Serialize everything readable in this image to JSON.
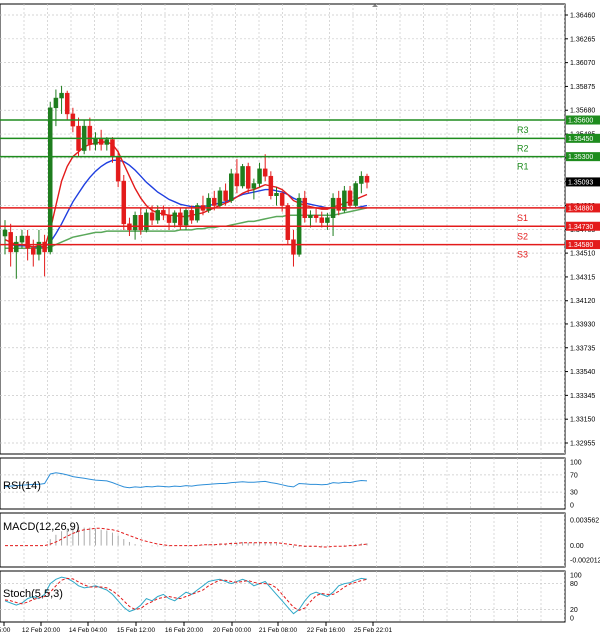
{
  "chart_data": {
    "type": "candlestick",
    "symbol_price_scale": {
      "ticks": [
        "1.36460",
        "1.36265",
        "1.36070",
        "1.35875",
        "1.35680",
        "1.35485",
        "1.35290",
        "1.35095",
        "1.34900",
        "1.34705",
        "1.34510",
        "1.34315",
        "1.34120",
        "1.33930",
        "1.33735",
        "1.33540",
        "1.33345",
        "1.33150",
        "1.32955"
      ],
      "current_price": "1.35093",
      "ylim": [
        1.32955,
        1.3646
      ]
    },
    "x_labels": [
      "5:00",
      "12 Feb 20:00",
      "14 Feb 04:00",
      "15 Feb 12:00",
      "16 Feb 20:00",
      "20 Feb 00:00",
      "21 Feb 08:00",
      "22 Feb 16:00",
      "25 Feb 22:01"
    ],
    "levels": [
      {
        "name": "R3",
        "price": 1.356,
        "label": "1.35600",
        "color": "#1e8c1e"
      },
      {
        "name": "R2",
        "price": 1.3545,
        "label": "1.35450",
        "color": "#1e8c1e"
      },
      {
        "name": "R1",
        "price": 1.353,
        "label": "1.35300",
        "color": "#1e8c1e"
      },
      {
        "name": "S1",
        "price": 1.3488,
        "label": "1.34880",
        "color": "#e31b1b"
      },
      {
        "name": "S2",
        "price": 1.3473,
        "label": "1.34730",
        "color": "#e31b1b"
      },
      {
        "name": "S3",
        "price": 1.3458,
        "label": "1.34580",
        "color": "#e31b1b"
      }
    ],
    "candles": [
      {
        "o": 1.3465,
        "h": 1.3478,
        "l": 1.345,
        "c": 1.347
      },
      {
        "o": 1.3468,
        "h": 1.3475,
        "l": 1.344,
        "c": 1.3452
      },
      {
        "o": 1.3452,
        "h": 1.3465,
        "l": 1.343,
        "c": 1.346
      },
      {
        "o": 1.346,
        "h": 1.347,
        "l": 1.3455,
        "c": 1.3465
      },
      {
        "o": 1.3465,
        "h": 1.347,
        "l": 1.3445,
        "c": 1.3455
      },
      {
        "o": 1.3455,
        "h": 1.3462,
        "l": 1.344,
        "c": 1.345
      },
      {
        "o": 1.345,
        "h": 1.347,
        "l": 1.3445,
        "c": 1.346
      },
      {
        "o": 1.346,
        "h": 1.3466,
        "l": 1.3432,
        "c": 1.3452
      },
      {
        "o": 1.3452,
        "h": 1.3575,
        "l": 1.345,
        "c": 1.357
      },
      {
        "o": 1.357,
        "h": 1.3585,
        "l": 1.3555,
        "c": 1.3578
      },
      {
        "o": 1.3578,
        "h": 1.3588,
        "l": 1.3565,
        "c": 1.3582
      },
      {
        "o": 1.3582,
        "h": 1.3584,
        "l": 1.356,
        "c": 1.3565
      },
      {
        "o": 1.3565,
        "h": 1.357,
        "l": 1.355,
        "c": 1.3555
      },
      {
        "o": 1.3555,
        "h": 1.3562,
        "l": 1.353,
        "c": 1.3535
      },
      {
        "o": 1.3535,
        "h": 1.356,
        "l": 1.3532,
        "c": 1.3555
      },
      {
        "o": 1.3555,
        "h": 1.3562,
        "l": 1.3535,
        "c": 1.354
      },
      {
        "o": 1.354,
        "h": 1.355,
        "l": 1.3535,
        "c": 1.3545
      },
      {
        "o": 1.3545,
        "h": 1.3552,
        "l": 1.3535,
        "c": 1.354
      },
      {
        "o": 1.354,
        "h": 1.3546,
        "l": 1.3535,
        "c": 1.3544
      },
      {
        "o": 1.3544,
        "h": 1.3546,
        "l": 1.3525,
        "c": 1.353
      },
      {
        "o": 1.353,
        "h": 1.3535,
        "l": 1.3505,
        "c": 1.351
      },
      {
        "o": 1.351,
        "h": 1.3515,
        "l": 1.347,
        "c": 1.3475
      },
      {
        "o": 1.3475,
        "h": 1.348,
        "l": 1.3465,
        "c": 1.347
      },
      {
        "o": 1.347,
        "h": 1.3485,
        "l": 1.3462,
        "c": 1.3482
      },
      {
        "o": 1.3482,
        "h": 1.3488,
        "l": 1.3466,
        "c": 1.347
      },
      {
        "o": 1.347,
        "h": 1.3487,
        "l": 1.3468,
        "c": 1.3484
      },
      {
        "o": 1.3484,
        "h": 1.349,
        "l": 1.3474,
        "c": 1.3478
      },
      {
        "o": 1.3478,
        "h": 1.349,
        "l": 1.3475,
        "c": 1.3486
      },
      {
        "o": 1.3486,
        "h": 1.349,
        "l": 1.3478,
        "c": 1.3482
      },
      {
        "o": 1.3482,
        "h": 1.3488,
        "l": 1.347,
        "c": 1.3476
      },
      {
        "o": 1.3476,
        "h": 1.3486,
        "l": 1.3472,
        "c": 1.3484
      },
      {
        "o": 1.3484,
        "h": 1.3488,
        "l": 1.347,
        "c": 1.3474
      },
      {
        "o": 1.3474,
        "h": 1.3488,
        "l": 1.347,
        "c": 1.3486
      },
      {
        "o": 1.3486,
        "h": 1.349,
        "l": 1.3475,
        "c": 1.3478
      },
      {
        "o": 1.3478,
        "h": 1.3492,
        "l": 1.3476,
        "c": 1.349
      },
      {
        "o": 1.349,
        "h": 1.3498,
        "l": 1.3482,
        "c": 1.3486
      },
      {
        "o": 1.3486,
        "h": 1.35,
        "l": 1.3484,
        "c": 1.3496
      },
      {
        "o": 1.3496,
        "h": 1.3502,
        "l": 1.3486,
        "c": 1.349
      },
      {
        "o": 1.349,
        "h": 1.3505,
        "l": 1.3488,
        "c": 1.3502
      },
      {
        "o": 1.3502,
        "h": 1.3508,
        "l": 1.349,
        "c": 1.3494
      },
      {
        "o": 1.3494,
        "h": 1.352,
        "l": 1.3492,
        "c": 1.3516
      },
      {
        "o": 1.3516,
        "h": 1.3528,
        "l": 1.35,
        "c": 1.3506
      },
      {
        "o": 1.3506,
        "h": 1.3524,
        "l": 1.3504,
        "c": 1.3522
      },
      {
        "o": 1.3522,
        "h": 1.3525,
        "l": 1.35,
        "c": 1.3504
      },
      {
        "o": 1.3504,
        "h": 1.3512,
        "l": 1.3495,
        "c": 1.3508
      },
      {
        "o": 1.3508,
        "h": 1.3525,
        "l": 1.3505,
        "c": 1.352
      },
      {
        "o": 1.352,
        "h": 1.3532,
        "l": 1.351,
        "c": 1.3514
      },
      {
        "o": 1.3514,
        "h": 1.3518,
        "l": 1.3495,
        "c": 1.3498
      },
      {
        "o": 1.3498,
        "h": 1.3505,
        "l": 1.349,
        "c": 1.35
      },
      {
        "o": 1.35,
        "h": 1.3502,
        "l": 1.3485,
        "c": 1.349
      },
      {
        "o": 1.349,
        "h": 1.3492,
        "l": 1.3458,
        "c": 1.3462
      },
      {
        "o": 1.3462,
        "h": 1.347,
        "l": 1.344,
        "c": 1.345
      },
      {
        "o": 1.345,
        "h": 1.35,
        "l": 1.3448,
        "c": 1.3496
      },
      {
        "o": 1.3496,
        "h": 1.3502,
        "l": 1.3476,
        "c": 1.348
      },
      {
        "o": 1.348,
        "h": 1.3486,
        "l": 1.3472,
        "c": 1.3482
      },
      {
        "o": 1.3482,
        "h": 1.3488,
        "l": 1.3476,
        "c": 1.348
      },
      {
        "o": 1.348,
        "h": 1.3485,
        "l": 1.3472,
        "c": 1.3476
      },
      {
        "o": 1.3476,
        "h": 1.3484,
        "l": 1.347,
        "c": 1.348
      },
      {
        "o": 1.348,
        "h": 1.35,
        "l": 1.3465,
        "c": 1.3496
      },
      {
        "o": 1.3496,
        "h": 1.3502,
        "l": 1.3482,
        "c": 1.3486
      },
      {
        "o": 1.3486,
        "h": 1.3506,
        "l": 1.3484,
        "c": 1.3502
      },
      {
        "o": 1.3502,
        "h": 1.3506,
        "l": 1.3488,
        "c": 1.349
      },
      {
        "o": 1.349,
        "h": 1.351,
        "l": 1.3488,
        "c": 1.3508
      },
      {
        "o": 1.3508,
        "h": 1.3518,
        "l": 1.35,
        "c": 1.3514
      },
      {
        "o": 1.3514,
        "h": 1.3516,
        "l": 1.3504,
        "c": 1.3509
      }
    ],
    "ma_fast": [
      1.3462,
      1.346,
      1.3458,
      1.3458,
      1.3457,
      1.3456,
      1.3457,
      1.3456,
      1.347,
      1.349,
      1.351,
      1.3522,
      1.353,
      1.3534,
      1.3538,
      1.354,
      1.3541,
      1.3542,
      1.3542,
      1.354,
      1.3534,
      1.3524,
      1.3514,
      1.3504,
      1.3496,
      1.349,
      1.3486,
      1.3484,
      1.3483,
      1.3482,
      1.3482,
      1.3481,
      1.3481,
      1.3482,
      1.3483,
      1.3484,
      1.3486,
      1.3488,
      1.349,
      1.3492,
      1.3494,
      1.3497,
      1.35,
      1.3502,
      1.3503,
      1.3505,
      1.3507,
      1.3506,
      1.3505,
      1.3503,
      1.3499,
      1.3494,
      1.3492,
      1.349,
      1.3489,
      1.3488,
      1.3487,
      1.3487,
      1.3489,
      1.349,
      1.3492,
      1.3493,
      1.3495,
      1.3497,
      1.3499
    ],
    "ma_mid": [
      1.3458,
      1.3458,
      1.3457,
      1.3457,
      1.3457,
      1.3456,
      1.3456,
      1.3456,
      1.346,
      1.3467,
      1.3475,
      1.3484,
      1.3493,
      1.35,
      1.3507,
      1.3513,
      1.3518,
      1.3522,
      1.3525,
      1.3527,
      1.3527,
      1.3526,
      1.3523,
      1.3519,
      1.3514,
      1.3509,
      1.3505,
      1.3501,
      1.3498,
      1.3495,
      1.3493,
      1.3491,
      1.349,
      1.3489,
      1.3489,
      1.3489,
      1.349,
      1.3491,
      1.3492,
      1.3493,
      1.3495,
      1.3497,
      1.3499,
      1.35,
      1.3501,
      1.3502,
      1.3503,
      1.3503,
      1.3502,
      1.3501,
      1.3499,
      1.3496,
      1.3494,
      1.3492,
      1.3491,
      1.349,
      1.3489,
      1.3488,
      1.3488,
      1.3488,
      1.3488,
      1.3488,
      1.3488,
      1.3489,
      1.349
    ],
    "ma_slow": [
      1.3455,
      1.3455,
      1.3455,
      1.3455,
      1.3455,
      1.3455,
      1.3455,
      1.3455,
      1.3456,
      1.3458,
      1.346,
      1.3462,
      1.3464,
      1.3465,
      1.3466,
      1.3467,
      1.3468,
      1.3468,
      1.3469,
      1.3469,
      1.3469,
      1.3469,
      1.3469,
      1.3469,
      1.3469,
      1.3469,
      1.3469,
      1.3469,
      1.3469,
      1.3469,
      1.3469,
      1.347,
      1.347,
      1.347,
      1.3471,
      1.3471,
      1.3472,
      1.3472,
      1.3473,
      1.3473,
      1.3474,
      1.3475,
      1.3476,
      1.3477,
      1.3477,
      1.3478,
      1.3479,
      1.348,
      1.3481,
      1.3481,
      1.3482,
      1.3482,
      1.3482,
      1.3482,
      1.3482,
      1.3482,
      1.3482,
      1.3482,
      1.3482,
      1.3483,
      1.3484,
      1.3485,
      1.3486,
      1.3487,
      1.3488
    ],
    "rsi": {
      "label": "RSI(14)",
      "ticks": [
        "100",
        "70",
        "30",
        "0"
      ],
      "values": [
        42,
        44,
        45,
        46,
        47,
        48,
        48,
        50,
        72,
        75,
        73,
        70,
        66,
        64,
        62,
        60,
        58,
        57,
        56,
        52,
        47,
        42,
        40,
        42,
        41,
        43,
        42,
        44,
        43,
        42,
        44,
        43,
        45,
        44,
        46,
        47,
        48,
        49,
        50,
        50,
        52,
        53,
        54,
        53,
        53,
        54,
        55,
        52,
        50,
        47,
        44,
        42,
        50,
        49,
        48,
        48,
        47,
        48,
        52,
        51,
        53,
        52,
        55,
        57,
        56
      ]
    },
    "macd": {
      "label": "MACD(12,26,9)",
      "ticks": [
        "0.003562",
        "0.00",
        "-0.002012"
      ],
      "hist": [
        0.0,
        0.0,
        -0.0001,
        0.0,
        0.0,
        0.0,
        0.0,
        0.0,
        0.0009,
        0.0015,
        0.002,
        0.0024,
        0.0026,
        0.0026,
        0.0025,
        0.0025,
        0.0024,
        0.0022,
        0.0021,
        0.0018,
        0.0014,
        0.0009,
        0.0005,
        0.0002,
        0.0001,
        0.0,
        -0.0001,
        -0.0001,
        -0.0001,
        -0.0001,
        0.0,
        0.0,
        0.0,
        0.0,
        0.0001,
        0.0001,
        0.0002,
        0.0002,
        0.0003,
        0.0003,
        0.0004,
        0.0004,
        0.0005,
        0.0004,
        0.0004,
        0.0005,
        0.0005,
        0.0004,
        0.0003,
        0.0001,
        -0.0001,
        -0.0003,
        -0.0002,
        -0.0002,
        -0.0002,
        -0.0002,
        -0.0002,
        -0.0001,
        0.0,
        0.0,
        0.0001,
        0.0001,
        0.0002,
        0.0003,
        0.0003
      ],
      "signal": [
        0.0,
        0.0,
        0.0,
        0.0,
        0.0,
        0.0,
        0.0,
        0.0,
        0.0002,
        0.0005,
        0.0009,
        0.0013,
        0.0017,
        0.002,
        0.0022,
        0.0023,
        0.0024,
        0.0024,
        0.0023,
        0.0022,
        0.002,
        0.0017,
        0.0014,
        0.0011,
        0.0008,
        0.0006,
        0.0004,
        0.0002,
        0.0001,
        0.0,
        0.0,
        0.0,
        0.0,
        0.0,
        0.0,
        0.0001,
        0.0001,
        0.0001,
        0.0002,
        0.0002,
        0.0003,
        0.0003,
        0.0004,
        0.0004,
        0.0004,
        0.0004,
        0.0004,
        0.0004,
        0.0004,
        0.0003,
        0.0002,
        0.0001,
        0.0,
        -0.0001,
        -0.0001,
        -0.0001,
        -0.0002,
        -0.0002,
        -0.0001,
        -0.0001,
        -0.0001,
        0.0,
        0.0,
        0.0001,
        0.0002
      ]
    },
    "stoch": {
      "label": "Stoch(5,5,3)",
      "ticks": [
        "100",
        "80",
        "20",
        "0"
      ],
      "main": [
        40,
        35,
        30,
        35,
        45,
        50,
        45,
        55,
        80,
        90,
        95,
        92,
        85,
        75,
        70,
        72,
        75,
        70,
        65,
        55,
        40,
        25,
        15,
        20,
        30,
        45,
        40,
        50,
        55,
        45,
        40,
        50,
        60,
        55,
        65,
        75,
        85,
        88,
        90,
        85,
        80,
        85,
        90,
        85,
        75,
        80,
        85,
        70,
        55,
        40,
        25,
        10,
        20,
        40,
        55,
        60,
        55,
        50,
        60,
        75,
        80,
        82,
        88,
        92,
        90
      ],
      "signal": [
        42,
        40,
        36,
        33,
        37,
        43,
        47,
        50,
        60,
        75,
        88,
        92,
        91,
        84,
        77,
        72,
        72,
        72,
        70,
        63,
        53,
        40,
        27,
        20,
        22,
        32,
        38,
        45,
        48,
        50,
        47,
        45,
        50,
        55,
        60,
        65,
        75,
        82,
        88,
        88,
        85,
        83,
        85,
        87,
        83,
        80,
        80,
        78,
        70,
        55,
        40,
        25,
        18,
        23,
        38,
        52,
        57,
        55,
        55,
        62,
        72,
        79,
        83,
        87,
        90
      ]
    },
    "colors": {
      "bull_candle": "#1e7d1e",
      "bear_candle": "#e31b1b",
      "ma_fast": "#1f3fe0",
      "ma_mid": "#e31b1b",
      "ma_slow": "#5aa85a",
      "rsi_line": "#2f8fd8",
      "macd_hist": "#aaaaaa",
      "macd_signal": "#e31b1b",
      "stoch_main": "#2fa8c8",
      "stoch_signal": "#e31b1b",
      "grid": "#c8c8c8"
    }
  }
}
